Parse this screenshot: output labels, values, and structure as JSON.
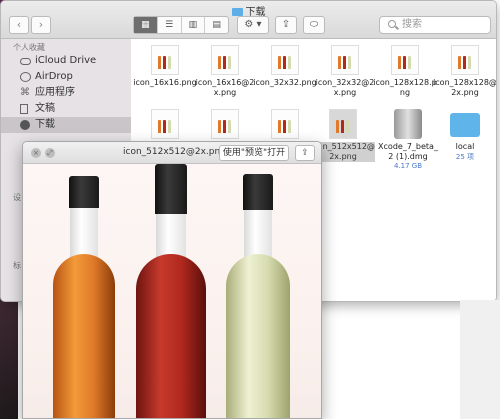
{
  "window": {
    "title": "下载"
  },
  "toolbar": {
    "back_label": "‹",
    "forward_label": "›",
    "view_icons": [
      "grid-icon",
      "list-icon",
      "columns-icon",
      "coverflow-icon"
    ],
    "arrange_label": "▦ ▾",
    "action_label": "⚙ ▾",
    "share_label": "⇪",
    "tag_label": "⬭",
    "search_placeholder": "搜索"
  },
  "sidebar": {
    "section_header": "个人收藏",
    "items": [
      {
        "label": "iCloud Drive",
        "icon": "cloud-icon"
      },
      {
        "label": "AirDrop",
        "icon": "airdrop-icon"
      },
      {
        "label": "应用程序",
        "icon": "applications-icon"
      },
      {
        "label": "文稿",
        "icon": "documents-icon"
      },
      {
        "label": "下载",
        "icon": "download-icon",
        "selected": true
      }
    ],
    "partial_labels": [
      "设",
      "标"
    ]
  },
  "files": [
    {
      "name": "icon_16x16.png"
    },
    {
      "name": "icon_16x16@2x.png"
    },
    {
      "name": "icon_32x32.png"
    },
    {
      "name": "icon_32x32@2x.png"
    },
    {
      "name": "icon_128x128.png"
    },
    {
      "name": "icon_128x128@2x.png"
    },
    {
      "name": "icon_512x512@2x.png",
      "selected": true
    },
    {
      "name": "Xcode_7_beta_2 (1).dmg",
      "sub": "4.17 GB"
    },
    {
      "name": "local",
      "sub": "25 项"
    }
  ],
  "quicklook": {
    "title": "icon_512x512@2x.png",
    "open_with_label": "使用\"预览\"打开",
    "share_label": "⇪",
    "close_label": "×",
    "fullscreen_label": "⤢"
  },
  "colors": {
    "accent": "#5eaee8",
    "folder": "#5fb5ea",
    "wine_orange": "#e07a2a",
    "wine_red": "#b0281e",
    "wine_white": "#d7dcb0"
  }
}
